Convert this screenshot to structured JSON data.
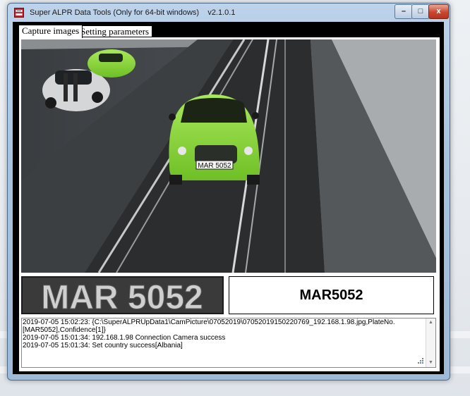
{
  "window": {
    "title": "Super ALPR Data Tools  (Only for 64-bit windows)",
    "version": "v2.1.0.1",
    "controls": {
      "minimize": "–",
      "maximize": "□",
      "close": "x"
    }
  },
  "tabs": [
    {
      "label": "Capture images",
      "active": true
    },
    {
      "label": "Setting parameters",
      "active": false
    }
  ],
  "plate": {
    "crop_text": "MAR 5052",
    "car_plate_text": "MAR 5052",
    "result": "MAR5052"
  },
  "log": [
    "2019-07-05 15:02:23: {C:\\SuperALPRUpData1\\CamPicture\\07052019\\07052019150220769_192.168.1.98.jpg,PlateNo.[MAR5052],Confidence[1]}",
    "2019-07-05 15:01:34: 192.168.1.98 Connection Camera success",
    "2019-07-05 15:01:34: Set country success[Albania]"
  ],
  "colors": {
    "car_green": "#8fd63a",
    "window_frame": "#a9c3df",
    "close_button": "#c9462f"
  },
  "icons": {
    "app": "app-icon",
    "scroll_up": "scroll-up-icon",
    "scroll_down": "scroll-down-icon"
  }
}
